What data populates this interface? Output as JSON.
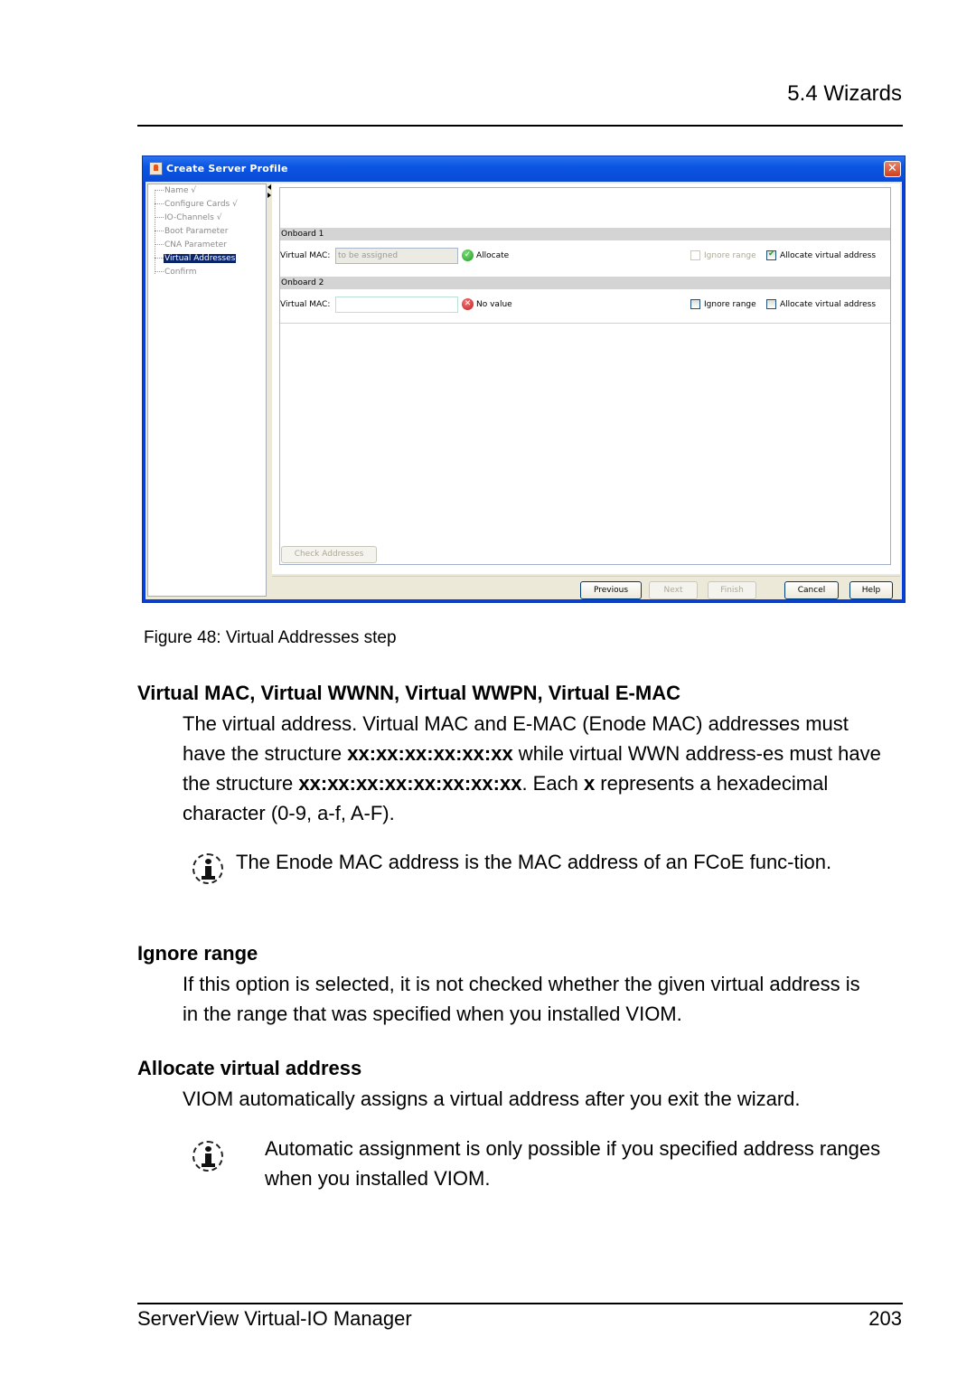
{
  "header": {
    "section": "5.4 Wizards"
  },
  "dialog": {
    "title": "Create Server Profile",
    "close_label": "✕",
    "tree": [
      {
        "label": "Name √",
        "selected": false
      },
      {
        "label": "Configure Cards √",
        "selected": false
      },
      {
        "label": "IO-Channels √",
        "selected": false
      },
      {
        "label": "Boot Parameter",
        "selected": false
      },
      {
        "label": "CNA Parameter",
        "selected": false
      },
      {
        "label": "Virtual Addresses",
        "selected": true
      },
      {
        "label": "Confirm",
        "selected": false
      }
    ],
    "groups": [
      {
        "title": "Onboard 1",
        "field_label": "Virtual MAC:",
        "field_value": "",
        "field_placeholder": "to be assigned",
        "field_disabled": true,
        "status": "Allocate",
        "status_icon": "ok-icon",
        "ignore_range": {
          "label": "Ignore range",
          "checked": false,
          "disabled": true
        },
        "allocate": {
          "label": "Allocate virtual address",
          "checked": true,
          "disabled": false
        }
      },
      {
        "title": "Onboard 2",
        "field_label": "Virtual MAC:",
        "field_value": "",
        "field_placeholder": "",
        "field_disabled": false,
        "status": "No value",
        "status_icon": "error-icon",
        "ignore_range": {
          "label": "Ignore range",
          "checked": false,
          "disabled": false
        },
        "allocate": {
          "label": "Allocate virtual address",
          "checked": false,
          "disabled": false
        }
      }
    ],
    "check_addresses_label": "Check Addresses",
    "buttons": {
      "previous": "Previous",
      "next": "Next",
      "finish": "Finish",
      "cancel": "Cancel",
      "help": "Help"
    }
  },
  "caption": "Figure 48: Virtual Addresses step",
  "sections": {
    "virtual_mac": {
      "term": "Virtual MAC, Virtual WWNN, Virtual WWPN, Virtual E-MAC",
      "p1": "The virtual address. Virtual MAC and E-MAC (Enode MAC) addresses must have the structure ",
      "mac_pattern": "xx:xx:xx:xx:xx:xx",
      "p2": " while virtual WWN address-es must have the structure ",
      "wwn_pattern": "xx:xx:xx:xx:xx:xx:xx:xx",
      "p3": ". Each ",
      "x": "x",
      "p4": " represents a hexadecimal character (0-9, a-f, A-F).",
      "note": "The Enode MAC address is the MAC address of an FCoE func-tion."
    },
    "ignore_range": {
      "term": "Ignore range",
      "text": "If this option is selected, it is not checked whether the given virtual address is in the range that was specified when you installed VIOM."
    },
    "allocate": {
      "term": "Allocate virtual address",
      "text": "VIOM automatically assigns a virtual address after you exit the wizard.",
      "note": "Automatic assignment is only possible if you specified address ranges when you installed VIOM."
    }
  },
  "footer": {
    "title": "ServerView Virtual-IO Manager",
    "page": "203"
  }
}
